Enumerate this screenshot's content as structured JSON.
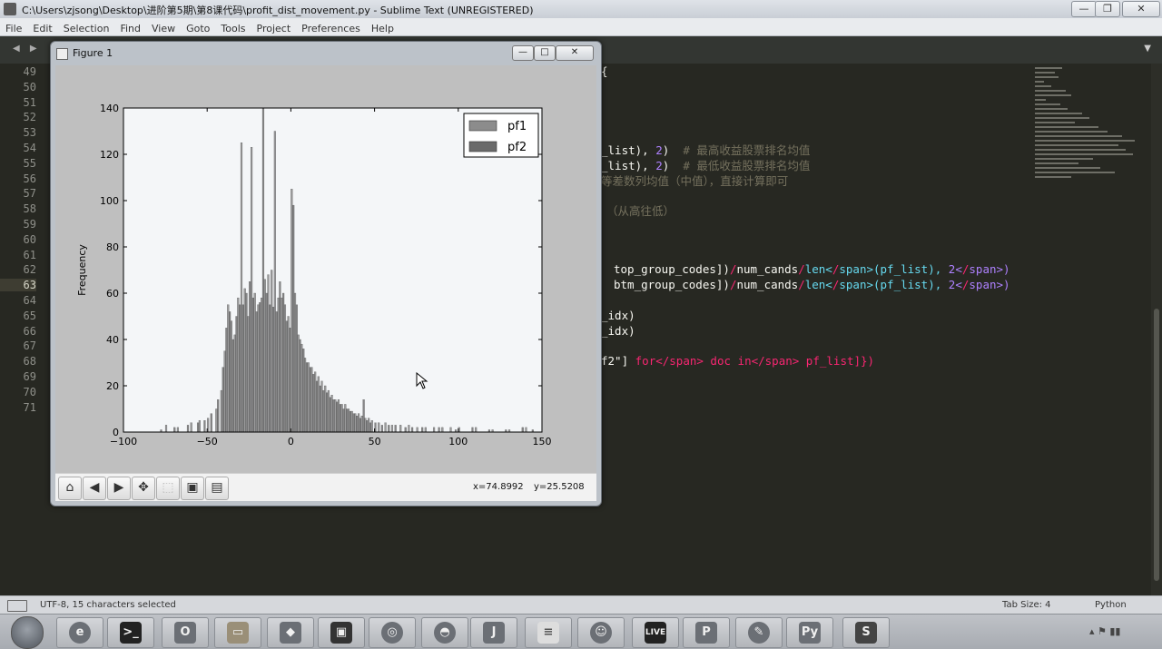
{
  "window": {
    "title": "C:\\Users\\zjsong\\Desktop\\进阶第5期\\第8课代码\\profit_dist_movement.py - Sublime Text (UNREGISTERED)",
    "minimize": "—",
    "maximize": "❐",
    "close": "✕"
  },
  "menu": [
    "File",
    "Edit",
    "Selection",
    "Find",
    "View",
    "Goto",
    "Tools",
    "Project",
    "Preferences",
    "Help"
  ],
  "tabs": {
    "arrows": "◀ ▶",
    "dropdown": "▼"
  },
  "editor": {
    "line_numbers": [
      "49",
      "50",
      "51",
      "52",
      "53",
      "54",
      "55",
      "56",
      "57",
      "58",
      "59",
      "60",
      "61",
      "62",
      "63",
      "64",
      "65",
      "66",
      "67",
      "68",
      "69",
      "70",
      "71"
    ],
    "active_line": "63",
    "lines": [
      {
        "n": "49",
        "text": "{"
      },
      {
        "n": "54",
        "text": "_list), 2)  # 最高收益股票排名均值"
      },
      {
        "n": "55",
        "text": "_list), 2)  # 最低收益股票排名均值"
      },
      {
        "n": "56",
        "text": "等差数列均值（中值），直接计算即可"
      },
      {
        "n": "58",
        "text": "（从高往低）"
      },
      {
        "n": "62",
        "text": "top_group_codes])/num_cands/len(pf_list), 2)"
      },
      {
        "n": "63",
        "text": "btm_group_codes])/num_cands/len(pf_list), 2)"
      },
      {
        "n": "65",
        "text": "_idx)"
      },
      {
        "n": "66",
        "text": "_idx)"
      },
      {
        "n": "68",
        "text": "f2\"] for doc in pf_list]})"
      }
    ]
  },
  "status": {
    "encoding": "UTF-8, 15 characters selected",
    "tab_size": "Tab Size: 4",
    "syntax": "Python"
  },
  "figure": {
    "title": "Figure 1",
    "minimize": "—",
    "maximize": "□",
    "close": "✕",
    "toolbar": {
      "home_icon": "⌂",
      "back_icon": "◀",
      "forward_icon": "▶",
      "pan_icon": "✥",
      "zoom_icon": "⬚",
      "subplots_icon": "▣",
      "save_icon": "▤"
    },
    "coord_x": "x=74.8992",
    "coord_y": "y=25.5208"
  },
  "chart_data": {
    "type": "bar",
    "subtype": "overlapping histogram",
    "ylabel": "Frequency",
    "xlabel": "",
    "xlim": [
      -100,
      150
    ],
    "ylim": [
      0,
      140
    ],
    "xticks": [
      "−100",
      "−50",
      "0",
      "50",
      "100",
      "150"
    ],
    "yticks": [
      "0",
      "20",
      "40",
      "60",
      "80",
      "100",
      "120",
      "140"
    ],
    "legend": {
      "placement": "top-right",
      "entries": [
        "pf1",
        "pf2"
      ]
    },
    "series": [
      {
        "name": "pf1",
        "color": "#8c8c8c",
        "bins": [
          [
            -75,
            3
          ],
          [
            -68,
            2
          ],
          [
            -60,
            4
          ],
          [
            -55,
            5
          ],
          [
            -50,
            6
          ],
          [
            -45,
            10
          ],
          [
            -42,
            18
          ],
          [
            -40,
            35
          ],
          [
            -38,
            55
          ],
          [
            -36,
            48
          ],
          [
            -34,
            42
          ],
          [
            -32,
            58
          ],
          [
            -30,
            125
          ],
          [
            -28,
            62
          ],
          [
            -26,
            50
          ],
          [
            -24,
            123
          ],
          [
            -22,
            60
          ],
          [
            -20,
            55
          ],
          [
            -18,
            58
          ],
          [
            -16,
            66
          ],
          [
            -14,
            68
          ],
          [
            -12,
            70
          ],
          [
            -10,
            130
          ],
          [
            -8,
            58
          ],
          [
            -6,
            58
          ],
          [
            -4,
            55
          ],
          [
            -2,
            50
          ],
          [
            0,
            105
          ],
          [
            2,
            60
          ],
          [
            4,
            42
          ],
          [
            6,
            38
          ],
          [
            8,
            32
          ],
          [
            10,
            30
          ],
          [
            12,
            28
          ],
          [
            14,
            26
          ],
          [
            16,
            24
          ],
          [
            18,
            22
          ],
          [
            20,
            20
          ],
          [
            22,
            18
          ],
          [
            24,
            16
          ],
          [
            26,
            14
          ],
          [
            28,
            14
          ],
          [
            30,
            12
          ],
          [
            32,
            12
          ],
          [
            34,
            10
          ],
          [
            36,
            9
          ],
          [
            38,
            8
          ],
          [
            40,
            8
          ],
          [
            42,
            7
          ],
          [
            44,
            6
          ],
          [
            46,
            6
          ],
          [
            48,
            5
          ],
          [
            52,
            4
          ],
          [
            56,
            4
          ],
          [
            60,
            3
          ],
          [
            65,
            3
          ],
          [
            70,
            3
          ],
          [
            75,
            2
          ],
          [
            80,
            2
          ],
          [
            85,
            2
          ],
          [
            90,
            2
          ],
          [
            95,
            2
          ],
          [
            100,
            2
          ],
          [
            110,
            2
          ],
          [
            120,
            1
          ],
          [
            130,
            1
          ],
          [
            140,
            2
          ]
        ]
      },
      {
        "name": "pf2",
        "color": "#6a6a6a",
        "bins": [
          [
            -78,
            1
          ],
          [
            -70,
            2
          ],
          [
            -62,
            3
          ],
          [
            -56,
            4
          ],
          [
            -52,
            5
          ],
          [
            -48,
            8
          ],
          [
            -44,
            14
          ],
          [
            -41,
            28
          ],
          [
            -39,
            45
          ],
          [
            -37,
            52
          ],
          [
            -35,
            40
          ],
          [
            -33,
            50
          ],
          [
            -31,
            55
          ],
          [
            -29,
            55
          ],
          [
            -27,
            60
          ],
          [
            -25,
            65
          ],
          [
            -23,
            58
          ],
          [
            -21,
            52
          ],
          [
            -19,
            56
          ],
          [
            -17,
            140
          ],
          [
            -15,
            60
          ],
          [
            -13,
            55
          ],
          [
            -11,
            54
          ],
          [
            -9,
            52
          ],
          [
            -7,
            65
          ],
          [
            -5,
            60
          ],
          [
            -3,
            48
          ],
          [
            -1,
            45
          ],
          [
            1,
            98
          ],
          [
            3,
            55
          ],
          [
            5,
            40
          ],
          [
            7,
            36
          ],
          [
            9,
            30
          ],
          [
            11,
            28
          ],
          [
            13,
            25
          ],
          [
            15,
            22
          ],
          [
            17,
            20
          ],
          [
            19,
            18
          ],
          [
            21,
            17
          ],
          [
            23,
            15
          ],
          [
            25,
            14
          ],
          [
            27,
            13
          ],
          [
            29,
            12
          ],
          [
            31,
            10
          ],
          [
            33,
            10
          ],
          [
            35,
            9
          ],
          [
            37,
            8
          ],
          [
            39,
            7
          ],
          [
            41,
            6
          ],
          [
            43,
            14
          ],
          [
            45,
            5
          ],
          [
            47,
            4
          ],
          [
            50,
            4
          ],
          [
            54,
            3
          ],
          [
            58,
            3
          ],
          [
            62,
            3
          ],
          [
            68,
            2
          ],
          [
            72,
            2
          ],
          [
            78,
            2
          ],
          [
            88,
            2
          ],
          [
            98,
            1
          ],
          [
            108,
            2
          ],
          [
            118,
            1
          ],
          [
            128,
            1
          ],
          [
            138,
            2
          ],
          [
            144,
            1
          ]
        ]
      }
    ]
  }
}
